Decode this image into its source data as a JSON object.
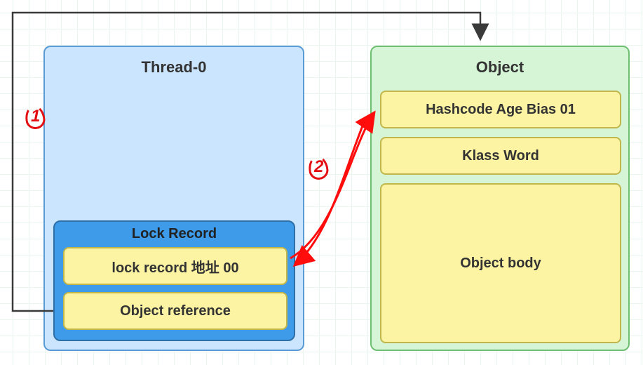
{
  "thread": {
    "title": "Thread-0",
    "lock_record": {
      "title": "Lock Record",
      "addr_label": "lock record 地址 00",
      "objref_label": "Object reference"
    }
  },
  "object": {
    "title": "Object",
    "hash_label": "Hashcode Age Bias 01",
    "klass_label": "Klass Word",
    "body_label": "Object body"
  },
  "annotations": {
    "mark1": "1",
    "mark2": "2"
  },
  "colors": {
    "thread_fill": "#cce5ff",
    "thread_border": "#5b9bd5",
    "lockrecord_fill": "#3d9be9",
    "lockrecord_border": "#2e6fa8",
    "object_fill": "#d6f5d6",
    "object_border": "#6fbf73",
    "cell_fill": "#fcf4a3",
    "cell_border": "#c0b64a",
    "arrow_black": "#3a3a3a",
    "arrow_red": "#ff0d0d",
    "annotation_red": "#e40f12"
  }
}
